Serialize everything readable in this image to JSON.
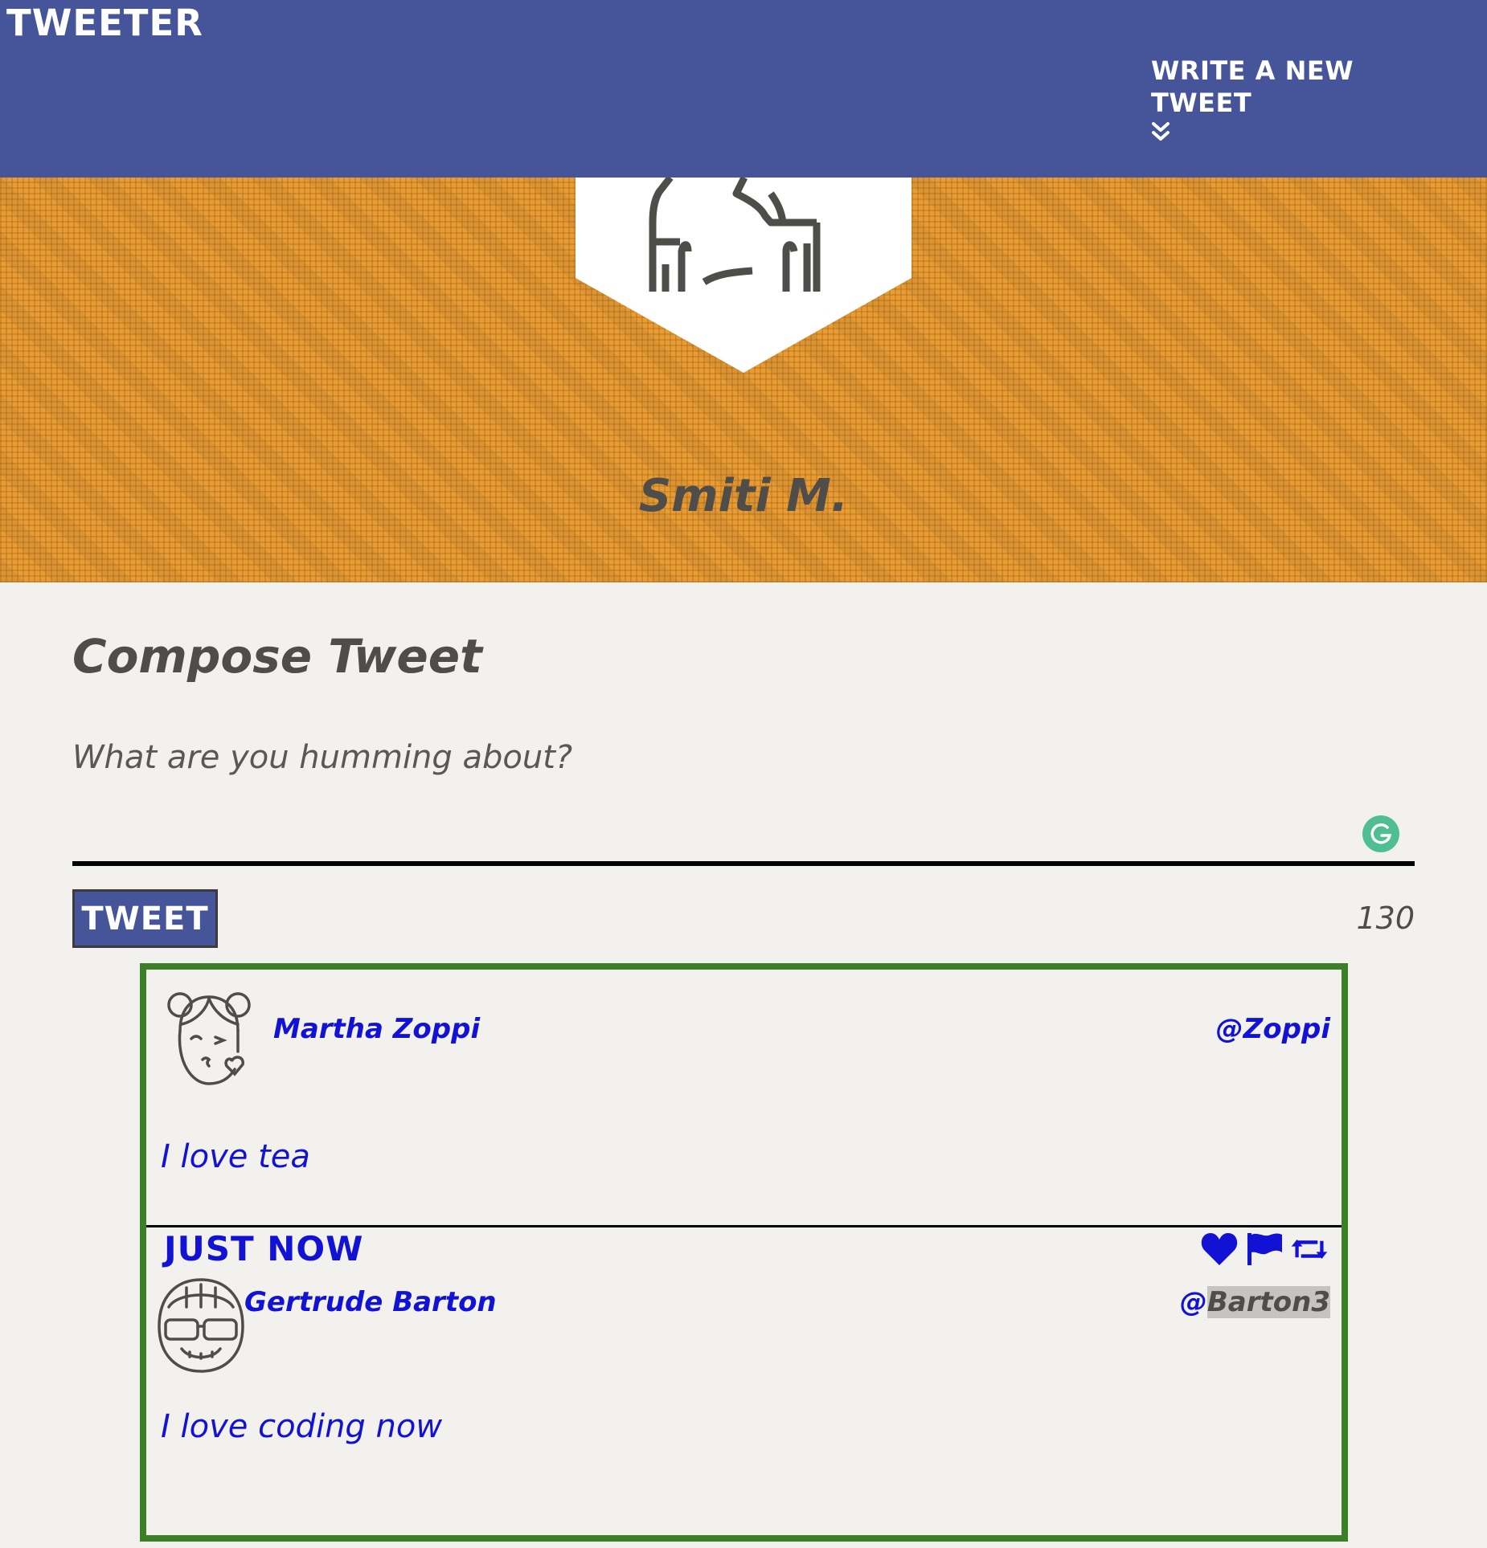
{
  "nav": {
    "brand": "TWEETER",
    "compose_toggle_label": "WRITE A NEW TWEET",
    "compose_toggle_icon": "double-chevron-down-icon"
  },
  "profile": {
    "name": "Smiti M.",
    "avatar_icon": "person-avatar-icon",
    "banner_color": "#e89c33"
  },
  "compose": {
    "title": "Compose Tweet",
    "placeholder": "What are you humming about?",
    "button_label": "TWEET",
    "char_count": "130",
    "assist_icon": "grammarly-icon"
  },
  "feed": {
    "border_color": "#3b7f26",
    "tweets": [
      {
        "author": "Martha Zoppi",
        "handle": "@Zoppi",
        "content": "I love tea",
        "time": "JUST NOW",
        "avatar_icon": "girl-kiss-avatar-icon",
        "actions": [
          "heart-icon",
          "flag-icon",
          "retweet-icon"
        ]
      },
      {
        "author": "Gertrude Barton",
        "handle_prefix": "@",
        "handle_highlight": "Barton3",
        "content": "I love coding now",
        "avatar_icon": "girl-sunglasses-avatar-icon"
      }
    ]
  },
  "colors": {
    "nav_bg": "#46549a",
    "page_bg": "#f3f1ee",
    "link_blue": "#1212d4",
    "text_dark": "#4f4d49"
  }
}
